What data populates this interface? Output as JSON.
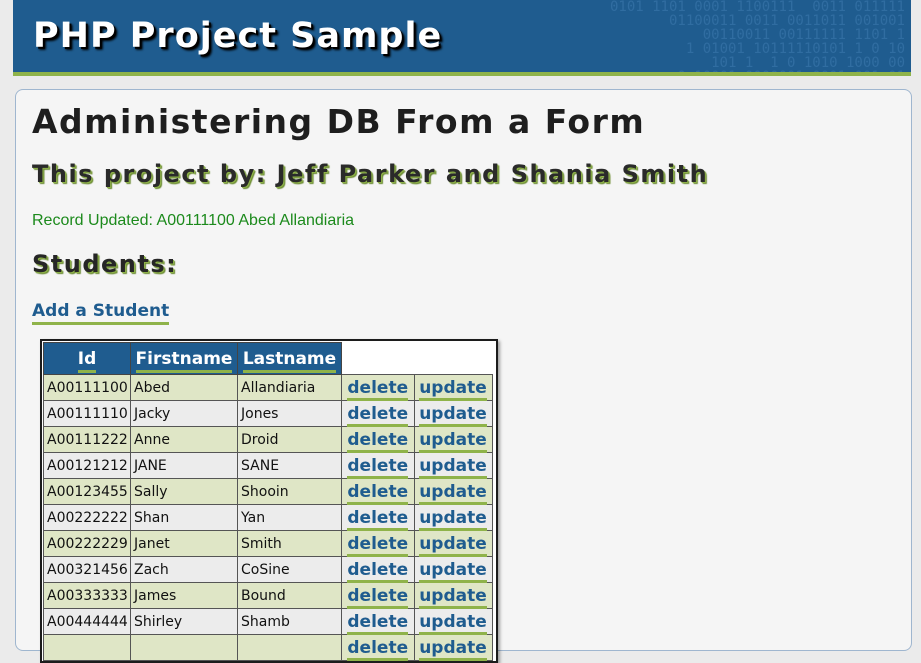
{
  "header": {
    "title": "PHP Project Sample"
  },
  "page": {
    "title": "Administering DB From a Form",
    "byline": "This project by: Jeff Parker and Shania Smith",
    "status": "Record Updated: A00111100 Abed Allandiaria",
    "students_heading": "Students:",
    "add_link": "Add a Student"
  },
  "table": {
    "headers": {
      "id": "Id",
      "firstname": "Firstname",
      "lastname": "Lastname"
    },
    "delete_label": "delete",
    "update_label": "update",
    "rows": [
      {
        "id": "A00111100",
        "first": "Abed",
        "last": "Allandiaria"
      },
      {
        "id": "A00111110",
        "first": "Jacky",
        "last": "Jones"
      },
      {
        "id": "A00111222",
        "first": "Anne",
        "last": "Droid"
      },
      {
        "id": "A00121212",
        "first": "JANE",
        "last": "SANE"
      },
      {
        "id": "A00123455",
        "first": "Sally",
        "last": "Shooin"
      },
      {
        "id": "A00222222",
        "first": "Shan",
        "last": "Yan"
      },
      {
        "id": "A00222229",
        "first": "Janet",
        "last": "Smith"
      },
      {
        "id": "A00321456",
        "first": "Zach",
        "last": "CoSine"
      },
      {
        "id": "A00333333",
        "first": "James",
        "last": "Bound"
      },
      {
        "id": "A00444444",
        "first": "Shirley",
        "last": "Shamb"
      },
      {
        "id": "",
        "first": "",
        "last": ""
      }
    ]
  }
}
